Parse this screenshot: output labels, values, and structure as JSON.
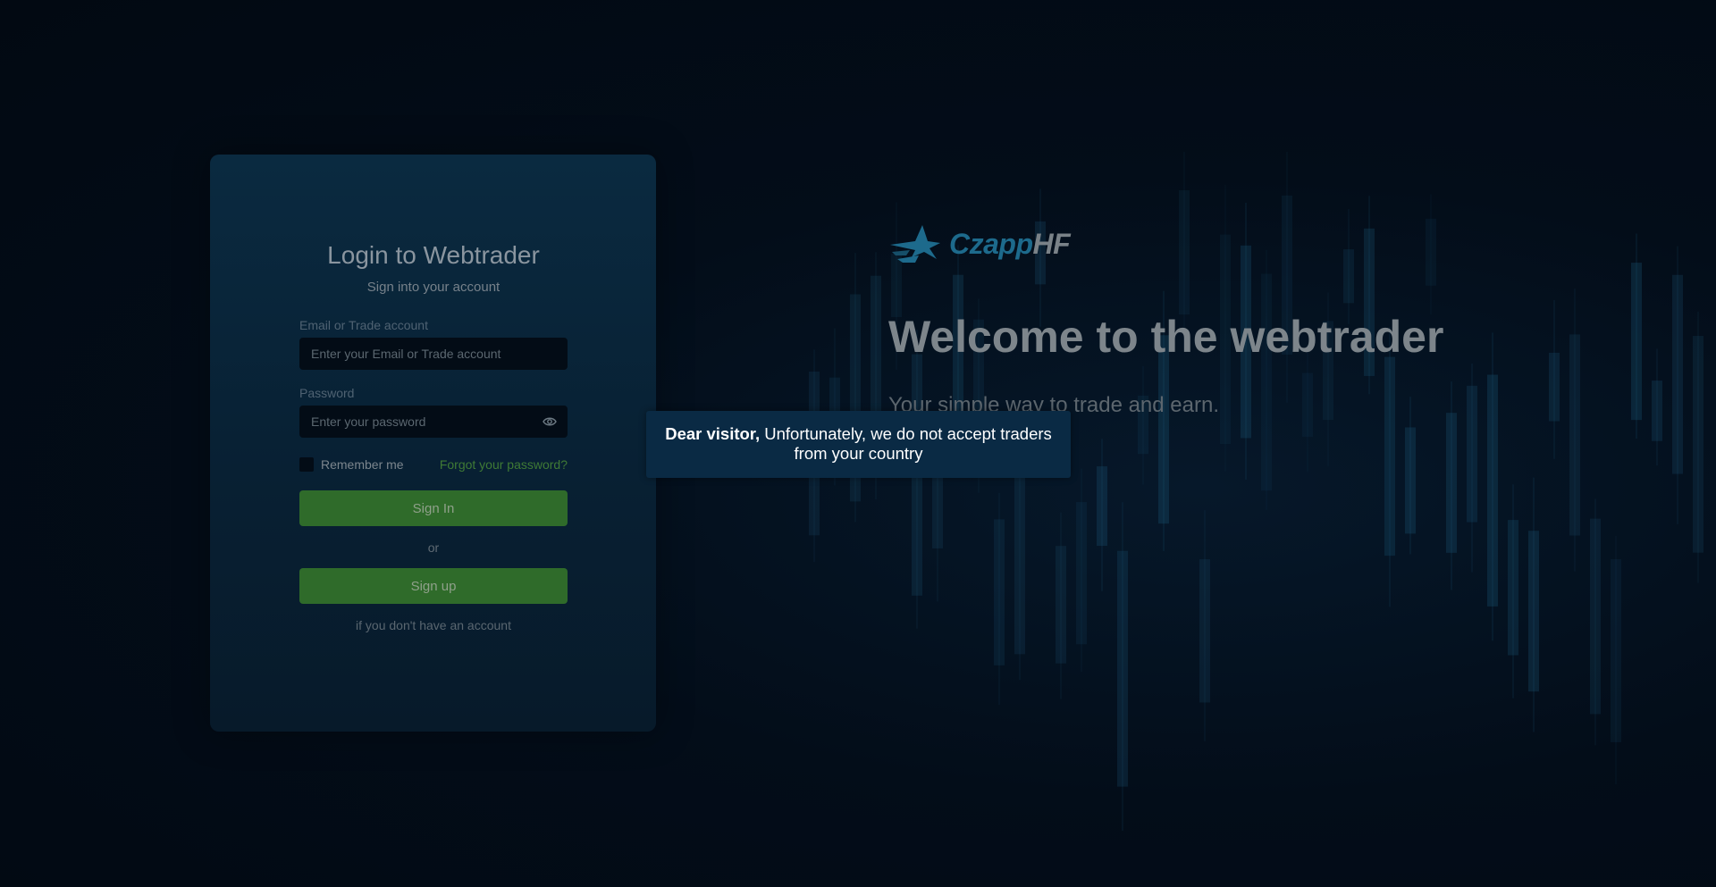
{
  "login": {
    "title": "Login to Webtrader",
    "subtitle": "Sign into your account",
    "email_label": "Email or Trade account",
    "email_placeholder": "Enter your Email or Trade account",
    "password_label": "Password",
    "password_placeholder": "Enter your password",
    "remember_label": "Remember me",
    "forgot_link": "Forgot your password?",
    "signin_button": "Sign In",
    "or_text": "or",
    "signup_button": "Sign up",
    "signup_note": "if you don't have an account"
  },
  "brand": {
    "name_part1": "Czapp",
    "name_part2": "HF"
  },
  "welcome": {
    "title": "Welcome to the webtrader",
    "subtitle": "Your simple way to trade and earn."
  },
  "notice": {
    "greeting": "Dear visitor,",
    "message": "Unfortunately, we do not accept traders from your country"
  },
  "colors": {
    "accent_green": "#2f6b2a",
    "brand_blue": "#1d6a8c",
    "notice_bg": "#0a2a44"
  },
  "icons": {
    "password_toggle": "eye-icon",
    "brand_logo": "shark-logo-icon"
  }
}
